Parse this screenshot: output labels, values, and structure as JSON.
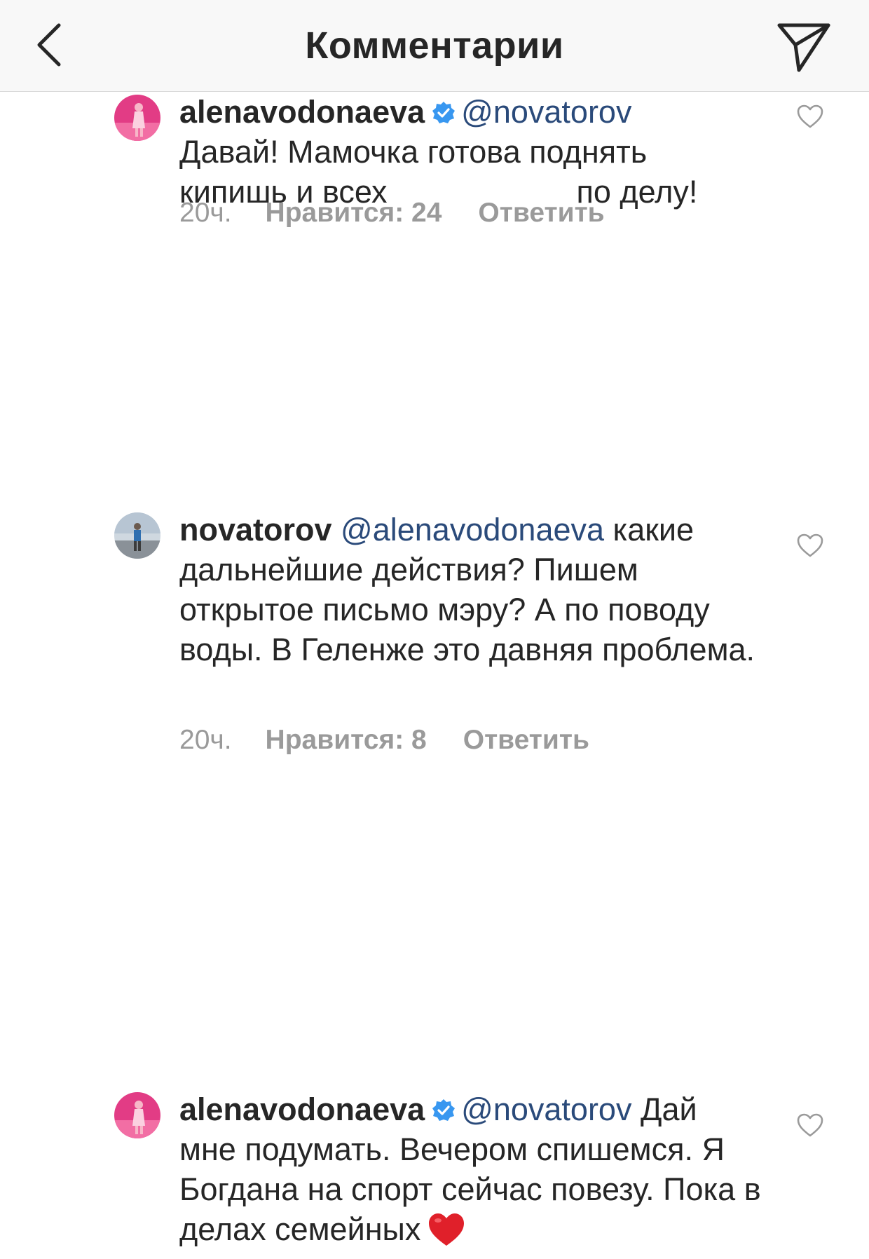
{
  "header": {
    "title": "Комментарии",
    "back_icon": "chevron-left-icon",
    "send_icon": "paper-plane-icon"
  },
  "colors": {
    "mention": "#2a4a7a",
    "meta": "#9a9a9a",
    "verified": "#3897f0",
    "heart_emoji": "#e0202a"
  },
  "comments": [
    {
      "username": "alenavodonaeva",
      "verified": true,
      "mention": "@novatorov",
      "text_line1": "Давай! Мамочка готова поднять",
      "text_line2a": "кипишь и всех",
      "text_line2b": "по делу!",
      "time": "20ч.",
      "likes": "Нравится: 24",
      "reply": "Ответить"
    },
    {
      "username": "novatorov",
      "verified": false,
      "mention": "@alenavodonaeva",
      "text_after_mention": " какие",
      "text_rest": "дальнейшие действия? Пишем открытое письмо мэру? А по поводу воды. В Геленже это давняя проблема.",
      "time": "20ч.",
      "likes": "Нравится: 8",
      "reply": "Ответить"
    },
    {
      "username": "alenavodonaeva",
      "verified": true,
      "mention": "@novatorov",
      "text_after_mention": " Дай",
      "text_rest": "мне подумать. Вечером спишемся. Я Богдана на спорт сейчас повезу. Пока в делах семейных",
      "emoji": "red-heart-emoji"
    }
  ]
}
